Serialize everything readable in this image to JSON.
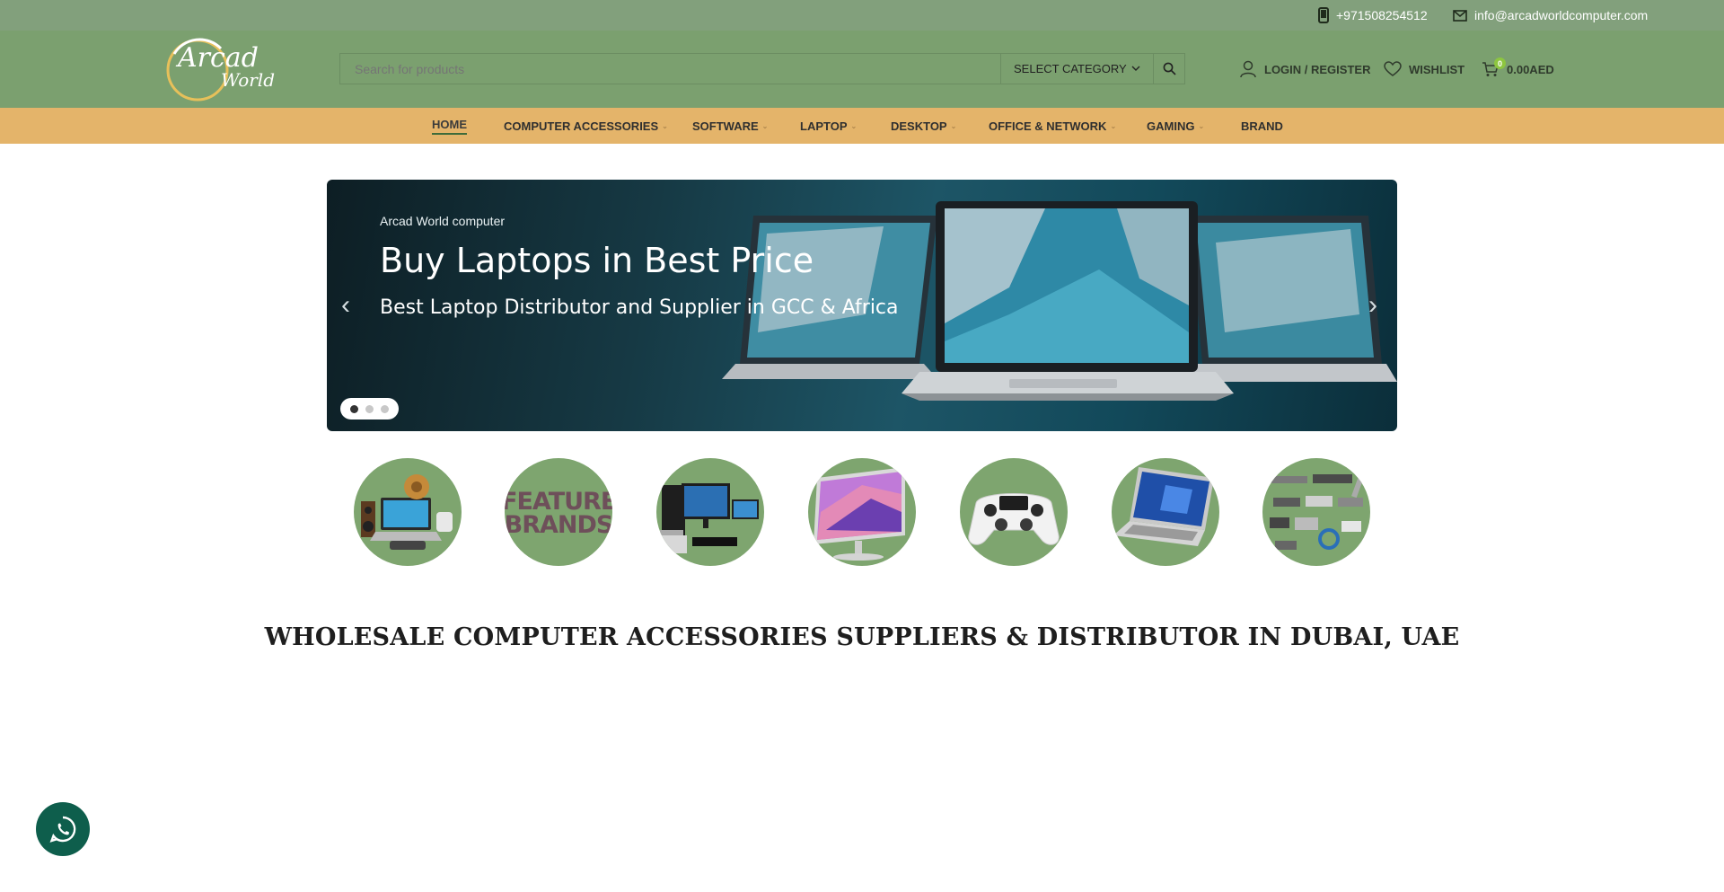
{
  "topbar": {
    "phone": "+971508254512",
    "email": "info@arcadworldcomputer.com"
  },
  "header": {
    "logo_text_1": "Arcad",
    "logo_text_2": "World",
    "search_placeholder": "Search for products",
    "category_label": "SELECT CATEGORY",
    "login_label": "LOGIN / REGISTER",
    "wishlist_label": "WISHLIST",
    "cart_count": "0",
    "cart_total": "0.00AED"
  },
  "nav": {
    "items": [
      {
        "label": "HOME"
      },
      {
        "label": "COMPUTER ACCESSORIES"
      },
      {
        "label": "SOFTWARE"
      },
      {
        "label": "LAPTOP"
      },
      {
        "label": "DESKTOP"
      },
      {
        "label": "OFFICE & NETWORK"
      },
      {
        "label": "GAMING"
      },
      {
        "label": "BRAND"
      }
    ]
  },
  "hero": {
    "kicker": "Arcad World computer",
    "title": "Buy Laptops in Best Price",
    "subtitle": "Best Laptop Distributor and Supplier in GCC & Africa",
    "slide_count": 3,
    "active_slide": 1
  },
  "categories": {
    "featured_line1": "FEATURED",
    "featured_line2": "BRANDS"
  },
  "headline": "WHOLESALE COMPUTER ACCESSORIES SUPPLIERS & DISTRIBUTOR IN DUBAI, UAE",
  "colors": {
    "topbar": "#82a07c",
    "header": "#7ba06f",
    "nav": "#e4b46a",
    "whatsapp": "#0e5e4c"
  }
}
